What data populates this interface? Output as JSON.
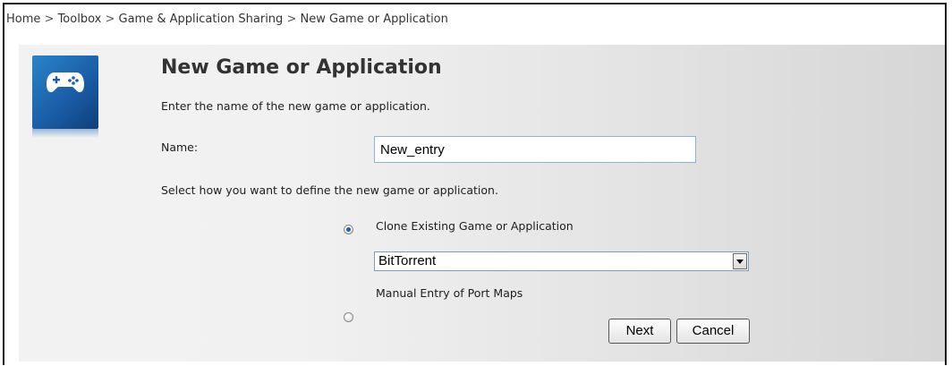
{
  "breadcrumb": {
    "items": [
      "Home",
      "Toolbox",
      "Game & Application Sharing",
      "New Game or Application"
    ],
    "separator": ">"
  },
  "header": {
    "icon": "gamepad-icon",
    "title": "New Game or Application",
    "description": "Enter the name of the new game or application."
  },
  "form": {
    "name_label": "Name:",
    "name_value": "New_entry",
    "select_description": "Select how you want to define the new game or application.",
    "options": {
      "clone_label": "Clone Existing Game or Application",
      "clone_checked": true,
      "manual_label": "Manual Entry of Port Maps",
      "manual_checked": false
    },
    "clone_select_value": "BitTorrent"
  },
  "buttons": {
    "next_label": "Next",
    "cancel_label": "Cancel"
  },
  "colors": {
    "icon_blue": "#1b5ea8",
    "input_border": "#8ab3d8",
    "radio_dot": "#2a5f9e"
  }
}
